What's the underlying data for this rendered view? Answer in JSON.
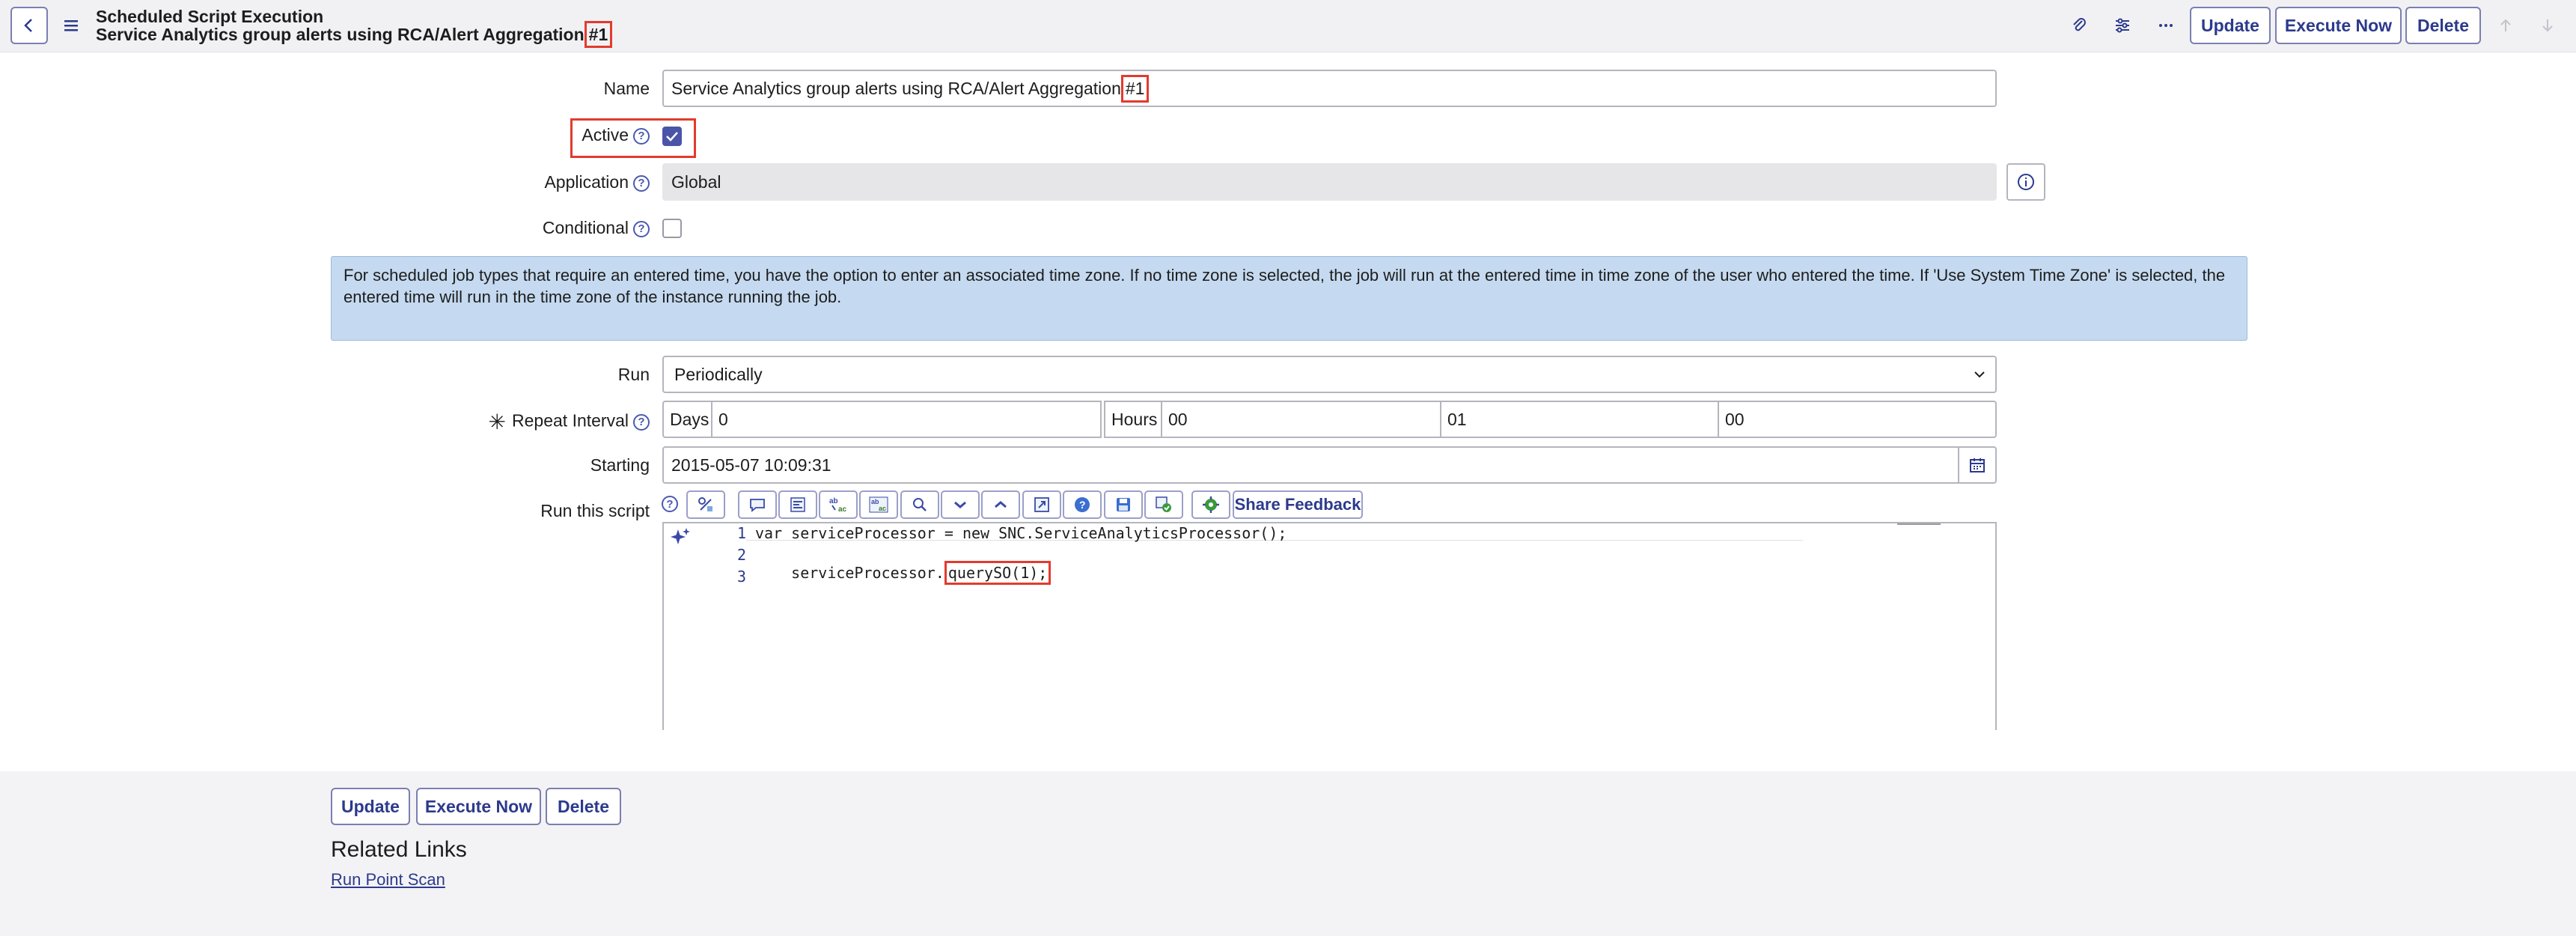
{
  "header": {
    "form_type": "Scheduled Script Execution",
    "record_name": "Service Analytics group alerts using RCA/Alert Aggregation",
    "record_suffix": "#1",
    "buttons": {
      "update": "Update",
      "execute_now": "Execute Now",
      "delete": "Delete"
    }
  },
  "form": {
    "name": {
      "label": "Name",
      "value_prefix": "Service Analytics group alerts using RCA/Alert Aggregation",
      "value_suffix": "#1"
    },
    "active": {
      "label": "Active",
      "checked": true
    },
    "application": {
      "label": "Application",
      "value": "Global"
    },
    "conditional": {
      "label": "Conditional",
      "checked": false
    },
    "info_message": "For scheduled job types that require an entered time, you have the option to enter an associated time zone. If no time zone is selected, the job will run at the entered time in time zone of the user who entered the time. If 'Use System Time Zone' is selected, the entered time will run in the time zone of the instance running the job.",
    "run": {
      "label": "Run",
      "value": "Periodically"
    },
    "repeat_interval": {
      "label": "Repeat Interval",
      "days_label": "Days",
      "days": "0",
      "hours_label": "Hours",
      "hours": "00",
      "minutes": "01",
      "seconds": "00"
    },
    "starting": {
      "label": "Starting",
      "value": "2015-05-07 10:09:31"
    },
    "script": {
      "label": "Run this script",
      "share_feedback": "Share Feedback",
      "line_numbers": [
        "1",
        "2",
        "3"
      ],
      "line1": "var serviceProcessor = new SNC.ServiceAnalyticsProcessor();",
      "line2_prefix": "serviceProcessor.",
      "line2_highlight": "querySO(1);",
      "line3": ""
    }
  },
  "footer": {
    "buttons": {
      "update": "Update",
      "execute_now": "Execute Now",
      "delete": "Delete"
    },
    "related_links_title": "Related Links",
    "links": [
      "Run Point Scan"
    ]
  },
  "colors": {
    "accent": "#2c3a8c",
    "highlight": "#e23b2e",
    "info_bg": "#c5daf0",
    "checkbox": "#4a54a8"
  }
}
